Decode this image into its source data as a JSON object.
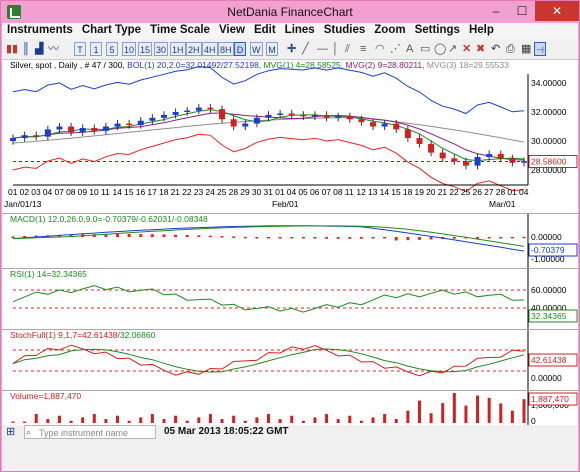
{
  "window": {
    "title": "NetDania FinanceChart",
    "min_label": "–",
    "max_label": "☐",
    "close_label": "✕"
  },
  "menu": [
    "Instruments",
    "Chart Type",
    "Time Scale",
    "View",
    "Edit",
    "Lines",
    "Studies",
    "Zoom",
    "Settings",
    "Help"
  ],
  "toolbar": {
    "periods": [
      "T",
      "1",
      "5",
      "10",
      "15",
      "30",
      "1H",
      "2H",
      "4H",
      "8H",
      "D",
      "W",
      "M"
    ],
    "selected_period": "D"
  },
  "price_panel": {
    "legend": [
      {
        "text": "Silver, spot , Daily , # 47 / 300, ",
        "color": "#000000"
      },
      {
        "text": "BOL(1) 20,2.0=32.01492/27.52198, ",
        "color": "#1a3fd0"
      },
      {
        "text": "MVG(1) 4=28.58525, ",
        "color": "#1f8a1f"
      },
      {
        "text": "MVG(2) 9=28.80211, ",
        "color": "#8b1d8b"
      },
      {
        "text": "MVG(3) 18=29.55533",
        "color": "#8e8e8e"
      }
    ],
    "y_labels": [
      "34.00000",
      "32.00000",
      "30.00000",
      "28.00000"
    ],
    "last_price": "28.58600",
    "x_labels": [
      "01",
      "02",
      "03",
      "04",
      "07",
      "08",
      "09",
      "10",
      "11",
      "14",
      "15",
      "16",
      "17",
      "18",
      "21",
      "22",
      "23",
      "24",
      "25",
      "28",
      "29",
      "30",
      "31",
      "01",
      "04",
      "05",
      "06",
      "07",
      "08",
      "11",
      "12",
      "13",
      "14",
      "15",
      "18",
      "19",
      "20",
      "21",
      "22",
      "25",
      "26",
      "27",
      "28",
      "01",
      "04"
    ],
    "x_months": [
      "Jan/01/13",
      "Feb/01",
      "Mar/01"
    ]
  },
  "macd_panel": {
    "legend": [
      {
        "text": "MACD(1) 12.0,26.0,9.0=-0.70379/-0.62031/-0.08348",
        "color": "#1f8a1f"
      }
    ],
    "y_labels": [
      "0.00000",
      "-1.00000"
    ],
    "last_value": "-0.70379"
  },
  "rsi_panel": {
    "legend": [
      {
        "text": "RSI(1) 14=32.34365",
        "color": "#1f8a1f"
      }
    ],
    "y_labels": [
      "60.00000",
      "40.00000"
    ],
    "last_value": "32.34365"
  },
  "stoch_panel": {
    "legend": [
      {
        "text": "StochFull(1) 9,1,7=42.61438/",
        "color": "#d21f1f"
      },
      {
        "text": "32.06860",
        "color": "#1f8a1f"
      }
    ],
    "y_labels": [
      "50.00000",
      "0.00000"
    ],
    "last_value": "42.61438"
  },
  "volume_panel": {
    "legend": [
      {
        "text": "Volume=1,887,470",
        "color": "#d21f1f"
      }
    ],
    "y_labels": [
      "1,000,000",
      "0"
    ],
    "last_value": "1,887,470"
  },
  "status": {
    "search_placeholder": "Type instrument name",
    "datetime": "05 Mar 2013 18:05:22 GMT"
  },
  "colors": {
    "bull": "#1a3fd0",
    "bear": "#d21f1f",
    "bol": "#1a3fd0",
    "mvg1": "#1f8a1f",
    "mvg2": "#8b1d8b",
    "mvg3": "#8e8e8e"
  }
}
